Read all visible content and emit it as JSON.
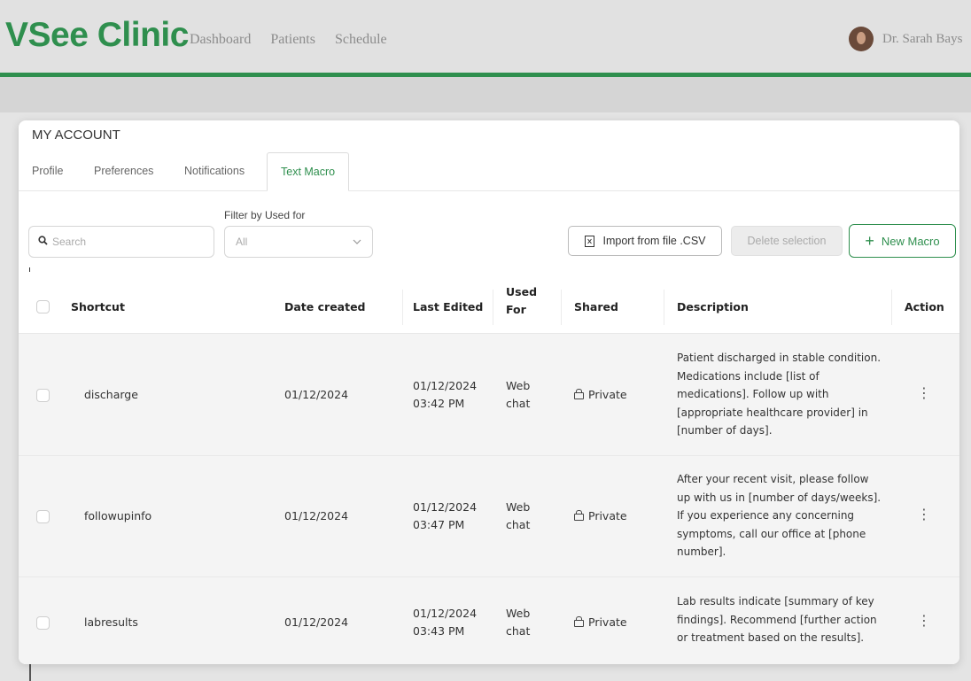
{
  "app": {
    "logo": "VSee Clinic",
    "nav": [
      "Dashboard",
      "Patients",
      "Schedule"
    ],
    "user": "Dr. Sarah Bays"
  },
  "modal": {
    "title": "MY ACCOUNT",
    "tabs": [
      "Profile",
      "Preferences",
      "Notifications",
      "Text Macro"
    ],
    "active_tab": "Text Macro"
  },
  "toolbar": {
    "search_placeholder": "Search",
    "filter_label": "Filter by Used for",
    "filter_value": "All",
    "import_label": "Import from file .CSV",
    "delete_label": "Delete selection",
    "new_label": "New Macro"
  },
  "table": {
    "headers": {
      "shortcut": "Shortcut",
      "date_created": "Date created",
      "last_edited": "Last Edited",
      "used_for_1": "Used",
      "used_for_2": "For",
      "shared": "Shared",
      "description": "Description",
      "action": "Action"
    },
    "rows": [
      {
        "shortcut": "discharge",
        "date_created": "01/12/2024",
        "last_edited_date": "01/12/2024",
        "last_edited_time": "03:42 PM",
        "used_for_1": "Web",
        "used_for_2": "chat",
        "shared": "Private",
        "description": "Patient discharged in stable condition. Medications include [list of medications]. Follow up with [appropriate healthcare provider] in [number of days]."
      },
      {
        "shortcut": "followupinfo",
        "date_created": "01/12/2024",
        "last_edited_date": "01/12/2024",
        "last_edited_time": "03:47 PM",
        "used_for_1": "Web",
        "used_for_2": "chat",
        "shared": "Private",
        "description": "After your recent visit, please follow up with us in [number of days/weeks]. If you experience any concerning symptoms, call our office at [phone number]."
      },
      {
        "shortcut": "labresults",
        "date_created": "01/12/2024",
        "last_edited_date": "01/12/2024",
        "last_edited_time": "03:43 PM",
        "used_for_1": "Web",
        "used_for_2": "chat",
        "shared": "Private",
        "description": "Lab results indicate [summary of key findings]. Recommend [further action or treatment based on the results]."
      }
    ]
  },
  "colors": {
    "brand": "#2f8f4e",
    "row_bg": "#f4f4f4",
    "page_bg": "#e4e4e4"
  },
  "icons": {
    "search": "search-icon",
    "chevron": "chevron-down-icon",
    "import": "file-icon",
    "new": "plus-icon",
    "shared": "lock-icon",
    "action": "kebab-menu-icon"
  }
}
